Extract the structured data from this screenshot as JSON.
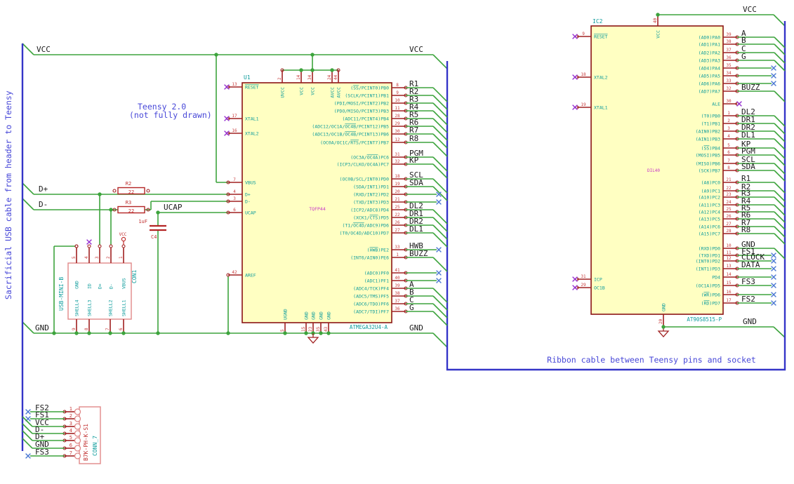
{
  "notes": {
    "cable": "Sacrificial USB cable from header to Teensy",
    "teensy1": "Teensy 2.0",
    "teensy2": "(not fully drawn)",
    "ribbon": "Ribbon cable between Teensy pins and socket"
  },
  "net": {
    "vcc": "VCC",
    "gnd": "GND",
    "dplus": "D+",
    "dminus": "D-",
    "ucap": "UCAP"
  },
  "colors": {
    "wire": "#3da43d",
    "pin": "#a02020",
    "pin_number": "#c83c3c",
    "pin_name": "#0e9c9c",
    "body_outline": "#8b1414",
    "body_fill": "#ffffc2",
    "net_label": "#1a1a1a",
    "note": "#4848d8",
    "cable": "#3535c8",
    "no_connect": "#4a78d2",
    "no_connect_pin": "#9632d2",
    "field": "#c838c8",
    "connector_outline": "#e08888"
  },
  "u1": {
    "ref": "U1",
    "value": "ATMEGA32U4-A",
    "package": "TQFP44",
    "right_pins": [
      {
        "num": "8",
        "name": "(~SS~/PCINT0)PB0",
        "label": "R1",
        "term": "cable"
      },
      {
        "num": "9",
        "name": "(SCLK/PCINT1)PB1",
        "label": "R2",
        "term": "cable"
      },
      {
        "num": "10",
        "name": "(PDI/MOSI/PCINT2)PB2",
        "label": "R3",
        "term": "cable"
      },
      {
        "num": "11",
        "name": "(PDO/MISO/PCINT3)PB3",
        "label": "R4",
        "term": "cable"
      },
      {
        "num": "28",
        "name": "(ADC11/PCINT4)PB4",
        "label": "R5",
        "term": "cable"
      },
      {
        "num": "29",
        "name": "(ADC12/OC1A/~OC4B~/PCINT12)PB5",
        "label": "R6",
        "term": "cable"
      },
      {
        "num": "30",
        "name": "(ADC13/OC1B/~OC4B~/PCINT13)PB6",
        "label": "R7",
        "term": "cable"
      },
      {
        "num": "12",
        "name": "(OC0A/OC1C/~RTS~/PCINT7)PB7",
        "label": "R8",
        "term": "cable"
      },
      {
        "num": "31",
        "name": "(OC3A/~OC4A~)PC6",
        "label": "PGM",
        "term": "cable"
      },
      {
        "num": "32",
        "name": "(ICP3/CLKO/OC4A)PC7",
        "label": "KP",
        "term": "cable"
      },
      {
        "num": "18",
        "name": "(OC0B/SCL/INT0)PD0",
        "label": "SCL",
        "term": "cable"
      },
      {
        "num": "19",
        "name": "(SDA/INT1)PD1",
        "label": "SDA",
        "term": "cable"
      },
      {
        "num": "20",
        "name": "(RXD/INT2)PD2",
        "label": "",
        "term": "nc"
      },
      {
        "num": "21",
        "name": "(TXD/INT3)PD3",
        "label": "",
        "term": "nc"
      },
      {
        "num": "25",
        "name": "(ICP2/ADC8)PD4",
        "label": "DL2",
        "term": "cable"
      },
      {
        "num": "22",
        "name": "(XCK1/~CTS~)PD5",
        "label": "DR1",
        "term": "cable"
      },
      {
        "num": "26",
        "name": "(T1/~OC4D~/ADC9)PD6",
        "label": "DR2",
        "term": "cable"
      },
      {
        "num": "27",
        "name": "(T0/OC4D/ADC10)PD7",
        "label": "DL1",
        "term": "cable"
      },
      {
        "num": "33",
        "name": "(~HWB~)PE2",
        "label": "HWB",
        "term": "nc"
      },
      {
        "num": "1",
        "name": "(INT6/AIN0)PE6",
        "label": "BUZZ",
        "term": "cable"
      },
      {
        "num": "41",
        "name": "(ADC0)PF0",
        "label": "",
        "term": "nc"
      },
      {
        "num": "40",
        "name": "(ADC1)PF1",
        "label": "",
        "term": "nc"
      },
      {
        "num": "39",
        "name": "(ADC4/TCK)PF4",
        "label": "A",
        "term": "cable"
      },
      {
        "num": "38",
        "name": "(ADC5/TMS)PF5",
        "label": "B",
        "term": "cable"
      },
      {
        "num": "37",
        "name": "(ADC6/TDO)PF6",
        "label": "C",
        "term": "cable"
      },
      {
        "num": "36",
        "name": "(ADC7/TDI)PF7",
        "label": "G",
        "term": "cable"
      }
    ],
    "left_pins": [
      {
        "num": "13",
        "name": "~RESET~",
        "term": "nc"
      },
      {
        "num": "17",
        "name": "XTAL1",
        "term": "nc"
      },
      {
        "num": "16",
        "name": "XTAL2",
        "term": "nc"
      },
      {
        "num": "7",
        "name": "VBUS",
        "term": "wire"
      },
      {
        "num": "4",
        "name": "D+",
        "term": "wire"
      },
      {
        "num": "3",
        "name": "D-",
        "term": "wire"
      },
      {
        "num": "6",
        "name": "UCAP",
        "term": "wire"
      },
      {
        "num": "42",
        "name": "AREF",
        "term": "wire"
      }
    ],
    "top_pins": [
      {
        "num": "2",
        "name": "UVCC"
      },
      {
        "num": "14",
        "name": "VCC"
      },
      {
        "num": "34",
        "name": "VCC"
      },
      {
        "num": "24",
        "name": "AVCC"
      },
      {
        "num": "44",
        "name": "AVCC"
      }
    ],
    "bottom_pins": [
      {
        "num": "5",
        "name": "UGND"
      },
      {
        "num": "15",
        "name": "GND"
      },
      {
        "num": "23",
        "name": "GND"
      },
      {
        "num": "35",
        "name": "GND"
      },
      {
        "num": "43",
        "name": "GND"
      }
    ]
  },
  "ic2": {
    "ref": "IC2",
    "value": "AT90S8515-P",
    "package": "DIL40",
    "right_pins": [
      {
        "num": "39",
        "name": "(AD0)PA0",
        "label": "A",
        "term": "cable"
      },
      {
        "num": "38",
        "name": "(AD1)PA1",
        "label": "B",
        "term": "cable"
      },
      {
        "num": "37",
        "name": "(AD2)PA2",
        "label": "C",
        "term": "cable"
      },
      {
        "num": "36",
        "name": "(AD3)PA3",
        "label": "G",
        "term": "cable"
      },
      {
        "num": "35",
        "name": "(AD4)PA4",
        "label": "",
        "term": "nc"
      },
      {
        "num": "34",
        "name": "(AD5)PA5",
        "label": "",
        "term": "nc"
      },
      {
        "num": "33",
        "name": "(AD6)PA6",
        "label": "",
        "term": "nc"
      },
      {
        "num": "32",
        "name": "(AD7)PA7",
        "label": "BUZZ",
        "term": "cable"
      },
      {
        "num": "30",
        "name": "ALE",
        "label": "",
        "term": "ncpin"
      },
      {
        "num": "1",
        "name": "(T0)PB0",
        "label": "DL2",
        "term": "cable"
      },
      {
        "num": "2",
        "name": "(T1)PB1",
        "label": "DR1",
        "term": "cable"
      },
      {
        "num": "3",
        "name": "(AIN0)PB2",
        "label": "DR2",
        "term": "cable"
      },
      {
        "num": "4",
        "name": "(AIN1)PB3",
        "label": "DL1",
        "term": "cable"
      },
      {
        "num": "5",
        "name": "(~SS~)PB4",
        "label": "KP",
        "term": "cable"
      },
      {
        "num": "6",
        "name": "(MOSI)PB5",
        "label": "PGM",
        "term": "cable"
      },
      {
        "num": "7",
        "name": "(MISO)PB6",
        "label": "SCL",
        "term": "cable"
      },
      {
        "num": "8",
        "name": "(SCK)PB7",
        "label": "SDA",
        "term": "cable"
      },
      {
        "num": "21",
        "name": "(A8)PC0",
        "label": "R1",
        "term": "cable"
      },
      {
        "num": "22",
        "name": "(A9)PC1",
        "label": "R2",
        "term": "cable"
      },
      {
        "num": "23",
        "name": "(A10)PC2",
        "label": "R3",
        "term": "cable"
      },
      {
        "num": "24",
        "name": "(A11)PC3",
        "label": "R4",
        "term": "cable"
      },
      {
        "num": "25",
        "name": "(A12)PC4",
        "label": "R5",
        "term": "cable"
      },
      {
        "num": "26",
        "name": "(A13)PC5",
        "label": "R6",
        "term": "cable"
      },
      {
        "num": "27",
        "name": "(A14)PC6",
        "label": "R7",
        "term": "cable"
      },
      {
        "num": "28",
        "name": "(A15)PC7",
        "label": "R8",
        "term": "cable"
      },
      {
        "num": "10",
        "name": "(RXD)PD0",
        "label": "GND",
        "term": "cable"
      },
      {
        "num": "11",
        "name": "(TXD)PD1",
        "label": "FS1",
        "term": "nc"
      },
      {
        "num": "12",
        "name": "(INT0)PD2",
        "label": "CLOCK",
        "term": "nc"
      },
      {
        "num": "13",
        "name": "(INT1)PD3",
        "label": "DATA",
        "term": "nc"
      },
      {
        "num": "14",
        "name": "PD4",
        "label": "",
        "term": "nc"
      },
      {
        "num": "15",
        "name": "(OC1A)PD5",
        "label": "FS3",
        "term": "nc"
      },
      {
        "num": "16",
        "name": "(~WR~)PD6",
        "label": "",
        "term": "nc"
      },
      {
        "num": "17",
        "name": "(~RD~)PD7",
        "label": "FS2",
        "term": "nc"
      }
    ],
    "left_pins": [
      {
        "num": "9",
        "name": "~RESET~",
        "term": "nc"
      },
      {
        "num": "18",
        "name": "XTAL2",
        "term": "nc"
      },
      {
        "num": "19",
        "name": "XTAL1",
        "term": "nc"
      },
      {
        "num": "31",
        "name": "ICP",
        "term": "nc"
      },
      {
        "num": "29",
        "name": "OC1B",
        "term": "nc"
      }
    ],
    "top_pins": [
      {
        "num": "40",
        "name": "VCC"
      }
    ],
    "bottom_pins": [
      {
        "num": "20",
        "name": "GND"
      }
    ]
  },
  "con1": {
    "ref": "CON1",
    "value": "USB-MINI-B",
    "top_pins": [
      {
        "num": "5",
        "name": "GND",
        "term": "wire"
      },
      {
        "num": "4",
        "name": "ID",
        "term": "nc"
      },
      {
        "num": "3",
        "name": "D+",
        "term": "wire"
      },
      {
        "num": "2",
        "name": "D-",
        "term": "wire"
      },
      {
        "num": "1",
        "name": "VBUS",
        "term": "vcc"
      }
    ],
    "bottom_pins": [
      {
        "num": "9",
        "name": "SHELL4"
      },
      {
        "num": "8",
        "name": "SHELL3"
      },
      {
        "num": "7",
        "name": "SHELL2"
      },
      {
        "num": "6",
        "name": "SHELL1"
      }
    ]
  },
  "conn7": {
    "ref": "CONN_7",
    "value": "B7K-PH-K-S1",
    "pins": [
      {
        "num": "1",
        "label": "FS2",
        "term": "nc"
      },
      {
        "num": "2",
        "label": "FS1",
        "term": "nc"
      },
      {
        "num": "3",
        "label": "VCC",
        "term": "cable"
      },
      {
        "num": "4",
        "label": "D-",
        "term": "cable"
      },
      {
        "num": "5",
        "label": "D+",
        "term": "cable"
      },
      {
        "num": "6",
        "label": "GND",
        "term": "cable"
      },
      {
        "num": "7",
        "label": "FS3",
        "term": "nc"
      }
    ]
  },
  "r2": {
    "ref": "R2",
    "value": "22"
  },
  "r3": {
    "ref": "R3",
    "value": "22"
  },
  "c4": {
    "ref": "C4",
    "value": "1uF"
  }
}
